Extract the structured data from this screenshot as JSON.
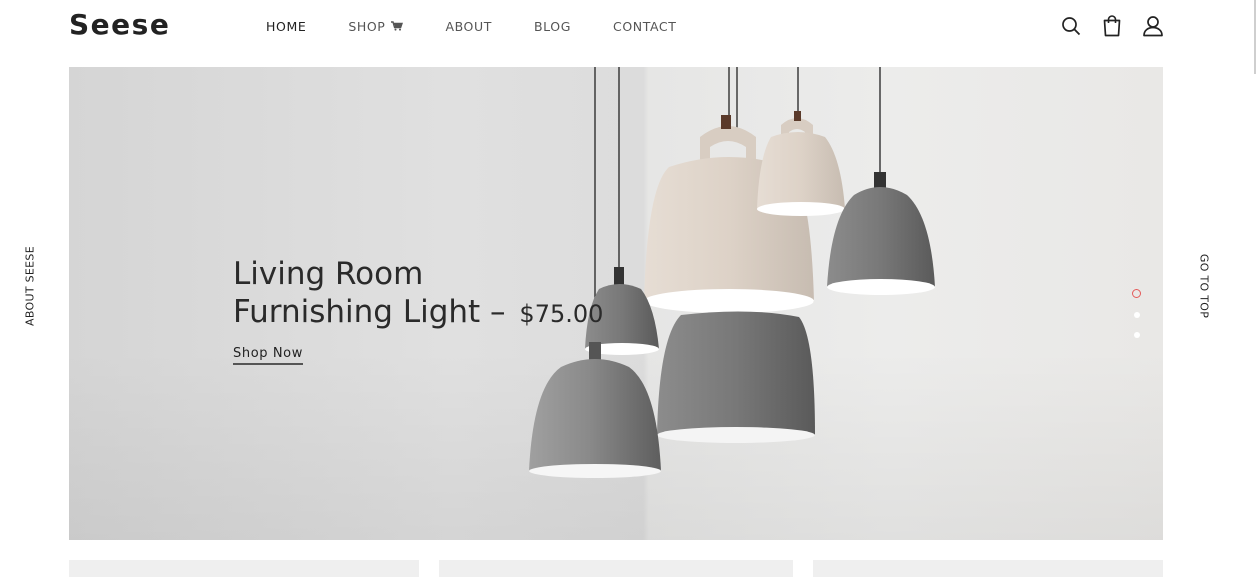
{
  "brand": {
    "logo": "Seese"
  },
  "nav": {
    "items": [
      {
        "label": "HOME",
        "active": true
      },
      {
        "label": "SHOP"
      },
      {
        "label": "ABOUT"
      },
      {
        "label": "BLOG"
      },
      {
        "label": "CONTACT"
      }
    ]
  },
  "header_icons": [
    "search-icon",
    "shopping-bag-icon",
    "user-icon"
  ],
  "hero": {
    "title_line1": "Living Room",
    "title_line2": "Furnishing Light –",
    "price": "$75.00",
    "cta": "Shop Now",
    "slides_total": 3,
    "active_slide": 1
  },
  "side": {
    "left": "ABOUT SEESE",
    "right": "GO TO TOP"
  },
  "colors": {
    "accent": "#e45a5a",
    "text": "#222222"
  }
}
